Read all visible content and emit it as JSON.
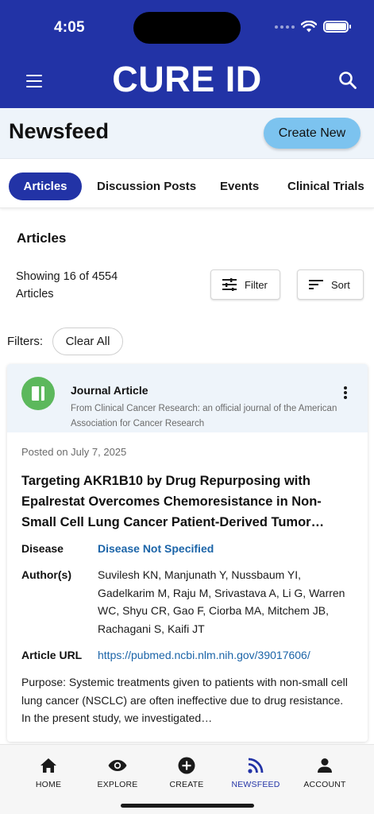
{
  "status_bar": {
    "time": "4:05"
  },
  "header": {
    "brand": "CURE ID"
  },
  "title_bar": {
    "title": "Newsfeed",
    "create_label": "Create New"
  },
  "tabs": [
    {
      "label": "Articles",
      "active": true
    },
    {
      "label": "Discussion Posts",
      "active": false
    },
    {
      "label": "Events",
      "active": false
    },
    {
      "label": "Clinical Trials",
      "active": false
    }
  ],
  "articles_section": {
    "title": "Articles",
    "count_text": "Showing 16 of 4554 Articles",
    "filter_label": "Filter",
    "sort_label": "Sort",
    "filters_label": "Filters:",
    "clear_all_label": "Clear All"
  },
  "article": {
    "type": "Journal Article",
    "source": "From Clinical Cancer Research: an official journal of the American Association for Cancer Research",
    "posted": "Posted on July 7, 2025",
    "title": "Targeting AKR1B10 by Drug Repurposing with Epalrestat Overcomes Chemoresistance in Non-Small Cell Lung Cancer Patient-Derived Tumor…",
    "disease_label": "Disease",
    "disease_value": "Disease Not Specified",
    "authors_label": "Author(s)",
    "authors_value": "Suvilesh KN, Manjunath Y, Nussbaum YI, Gadelkarim M, Raju M, Srivastava A, Li G, Warren WC, Shyu CR, Gao F, Ciorba MA, Mitchem JB, Rachagani S, Kaifi JT",
    "url_label": "Article URL",
    "url_value": "https://pubmed.ncbi.nlm.nih.gov/39017606/",
    "summary": "Purpose: Systemic treatments given to patients with non-small cell lung cancer (NSCLC) are often ineffective due to drug resistance. In the present study, we investigated…"
  },
  "bottom_nav": [
    {
      "label": "HOME",
      "icon": "home-icon",
      "active": false
    },
    {
      "label": "EXPLORE",
      "icon": "eye-icon",
      "active": false
    },
    {
      "label": "CREATE",
      "icon": "plus-circle-icon",
      "active": false
    },
    {
      "label": "NEWSFEED",
      "icon": "rss-icon",
      "active": true
    },
    {
      "label": "ACCOUNT",
      "icon": "person-icon",
      "active": false
    }
  ],
  "colors": {
    "brand_blue": "#2233a6",
    "create_button": "#7cc3ef",
    "link_blue": "#1b64a8",
    "journal_green": "#5cb85c",
    "card_header_bg": "#eef4fa"
  }
}
